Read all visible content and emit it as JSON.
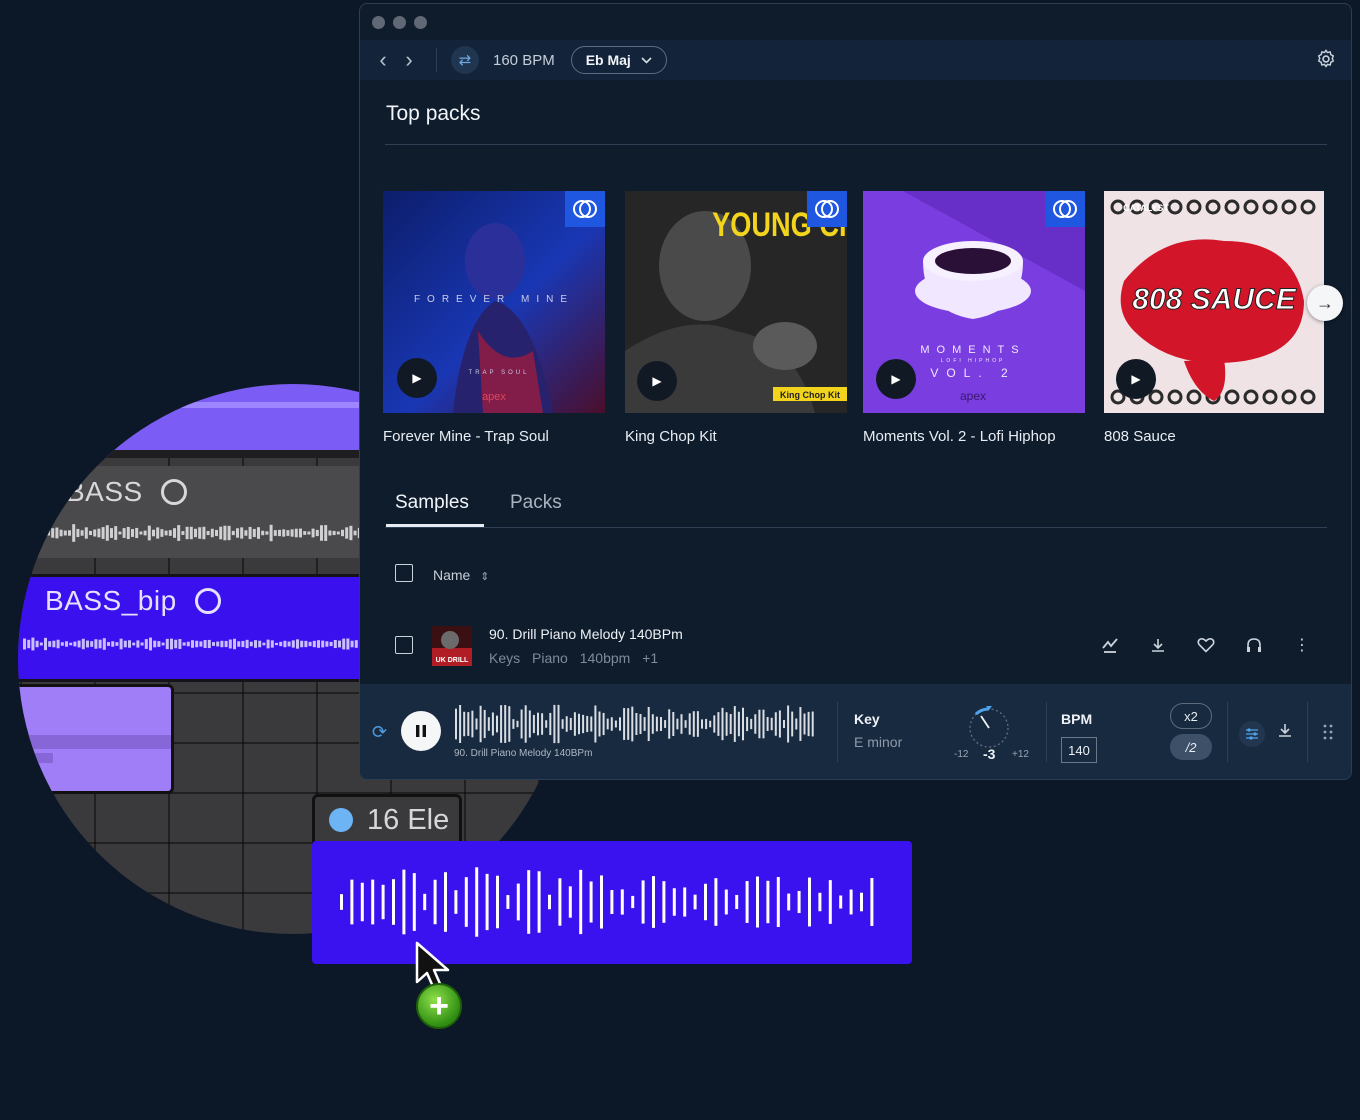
{
  "daw": {
    "tracks": [
      {
        "label": "BASS"
      },
      {
        "label": "BASS_bip"
      }
    ],
    "drag_tab_label": "16 Ele"
  },
  "toolbar": {
    "bpm": "160 BPM",
    "key": "Eb Maj"
  },
  "top_packs": {
    "title": "Top packs",
    "packs": [
      {
        "name": "Forever Mine - Trap Soul",
        "art_text": "FOREVER MINE",
        "art_sub": "TRAP SOUL",
        "art_brand": "apex",
        "badge": true
      },
      {
        "name": "King Chop Kit",
        "art_text": "YOUNG CHOP",
        "art_sub": "King Chop Kit",
        "badge": true
      },
      {
        "name": "Moments Vol. 2 - Lofi Hiphop",
        "art_text": "MOMENTS",
        "art_sub": "LOFI HIPHOP",
        "art_vol": "VOL. 2",
        "art_brand": "apex",
        "badge": true
      },
      {
        "name": "808 Sauce",
        "art_text": "808 SAUCE",
        "art_brand": "CATALYST",
        "badge": false
      }
    ]
  },
  "tabs": [
    {
      "label": "Samples",
      "active": true
    },
    {
      "label": "Packs",
      "active": false
    }
  ],
  "table": {
    "col_name": "Name",
    "rows": [
      {
        "title": "90. Drill Piano Melody 140BPm",
        "tags": [
          "Keys",
          "Piano",
          "140bpm",
          "+1"
        ],
        "thumb_text": "UK DRILL"
      }
    ]
  },
  "player": {
    "sample_name": "90. Drill Piano Melody 140BPm",
    "key_label": "Key",
    "key_value": "E minor",
    "pitch_min": "-12",
    "pitch_value": "-3",
    "pitch_max": "+12",
    "bpm_label": "BPM",
    "bpm_value": "140",
    "mult_x2": "x2",
    "mult_half": "/2"
  },
  "colors": {
    "bg": "#0c1827",
    "window": "#0f1c2c",
    "toolbar": "#13243a",
    "player": "#182a3f",
    "accent_blue": "#1f57e0",
    "clip_purple": "#3a12f0"
  }
}
